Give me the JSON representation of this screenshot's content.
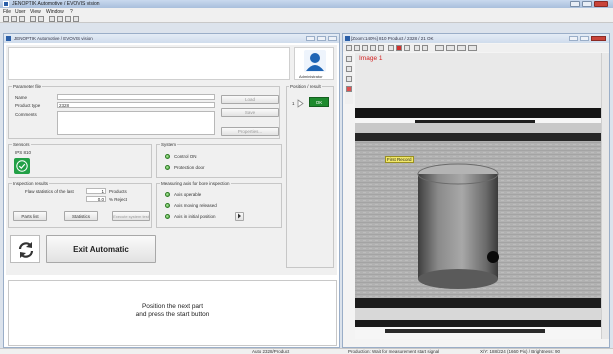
{
  "app": {
    "title": "JENOPTIK Automotive / EVOVIS vision",
    "menu": [
      "File",
      "User",
      "View",
      "Window",
      "?"
    ]
  },
  "evovis": {
    "title": "JENOPTIK Automotive / EVOVIS vision",
    "user_role": "Administrator",
    "parameter_file": {
      "legend": "Parameter file",
      "name_label": "Name",
      "product_type_label": "Product type",
      "product_type_value": "2328",
      "comments_label": "Comments",
      "load_button": "Load",
      "save_button": "Save",
      "properties_button": "Properties..."
    },
    "position_result": {
      "legend": "Position / result",
      "position_value": "1",
      "result_value": "OK"
    },
    "sensors": {
      "legend": "Sensors",
      "sensor_name": "IPS 810"
    },
    "system": {
      "legend": "System",
      "items": [
        "Control ON",
        "Protection door"
      ]
    },
    "inspection": {
      "legend": "Inspection results",
      "flaw_label": "Flaw statistics of the last",
      "flaw_count": "1",
      "flaw_unit": "Products",
      "reject_value": "0.0",
      "reject_unit": "% Reject",
      "parts_list_button": "Parts list",
      "statistics_button": "Statistics",
      "execute_button": "Execute system test"
    },
    "measuring_axis": {
      "legend": "Measuring axis for bore inspection",
      "items": [
        "Axis operable",
        "Axis moving released",
        "Axis in initial position"
      ]
    },
    "exit_button": "Exit Automatic",
    "message_line1": "Position the next part",
    "message_line2": "and press the start button"
  },
  "image_window": {
    "title": "[Zoom:140%] 810 Product / 2328 / 21 OK",
    "image_label": "Image 1",
    "record_label": "First Record"
  },
  "status": {
    "auto": "Auto 2328/Product",
    "production": "Production: Wait for measurement start signal",
    "coords": "X/Y: 188/224 (1660 Pix) / Brightness: 90"
  },
  "colors": {
    "ok_green": "#1e8a2e",
    "image_label_red": "#d42020",
    "record_label_bg": "#f2e86a"
  }
}
